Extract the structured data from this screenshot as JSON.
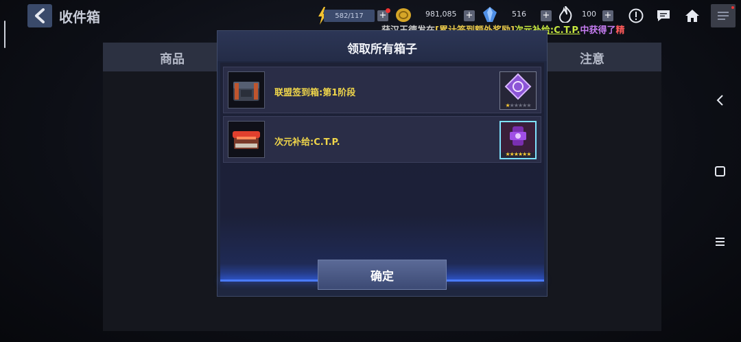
{
  "topbar": {
    "title": "收件箱",
    "energy": "582/117",
    "gold": "981,085",
    "crystals": "516",
    "flame": "100",
    "plus": "+"
  },
  "ticker": {
    "part1": "获汉王德发在",
    "part2": "[累计签到额外奖励]",
    "part3": "次元补给:C.T.P.",
    "part4": "中获得了",
    "part5": "精"
  },
  "background": {
    "col_goods": "商品",
    "col_notice": "注意"
  },
  "modal": {
    "title": "领取所有箱子",
    "items": [
      {
        "name": "联盟签到箱:第1阶段",
        "stars_on": 1,
        "stars_total": 6
      },
      {
        "name": "次元补给:C.T.P.",
        "stars_on": 6,
        "stars_total": 6
      }
    ],
    "confirm_label": "确定"
  },
  "colors": {
    "accent_gold": "#f0d64a",
    "button": "#4b5a86",
    "glow": "#4a7bff"
  }
}
